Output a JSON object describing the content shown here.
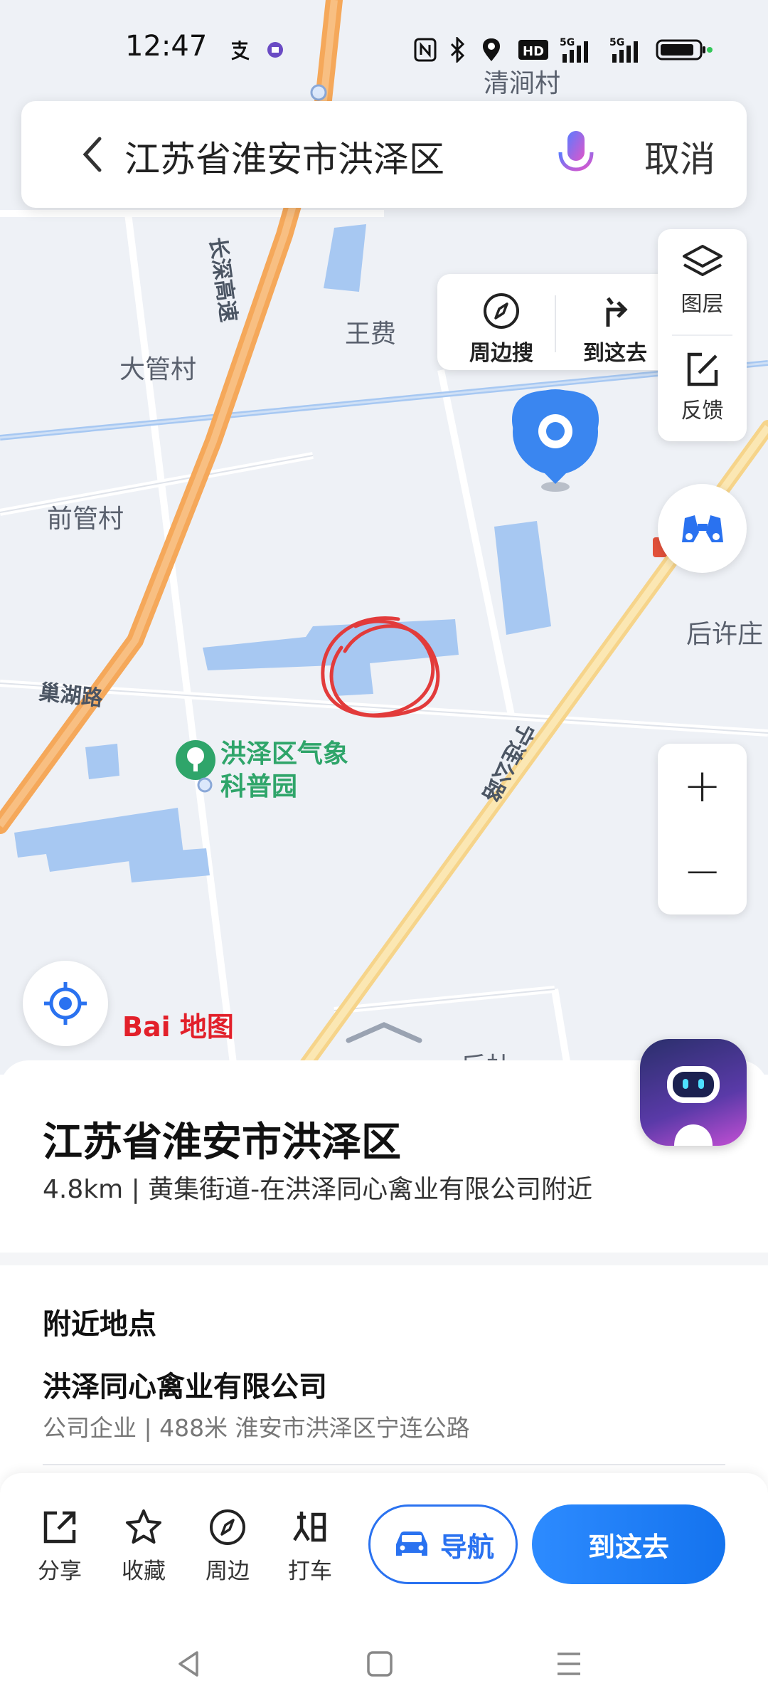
{
  "status_bar": {
    "time": "12:47",
    "icons": [
      "alipay-icon",
      "app-notification-icon",
      "nfc-icon",
      "bluetooth-icon",
      "location-icon",
      "hd-icon",
      "signal-5g-icon",
      "signal-5g-icon",
      "battery-icon"
    ],
    "hd_label": "HD",
    "net1": "5G",
    "net2": "5G"
  },
  "search": {
    "query": "江苏省淮安市洪泽区",
    "cancel_label": "取消"
  },
  "map": {
    "labels": {
      "qingjian": "清涧村",
      "wangfei": "王费",
      "daguan": "大管村",
      "qianguan": "前管村",
      "houxu": "后许庄",
      "chaohu": "巢湖路",
      "highway": "长深高速",
      "ninglian": "宁连公路",
      "park_line1": "洪泽区气象",
      "park_line2": "科普园",
      "partial_bottom": "后杜"
    },
    "logo": "Bai 地图"
  },
  "controls": {
    "nearby_search": "周边搜",
    "go_here": "到这去",
    "layers": "图层",
    "feedback": "反馈",
    "zoom_in": "+",
    "zoom_out": "−"
  },
  "sheet": {
    "title": "江苏省淮安市洪泽区",
    "subtitle": "4.8km | 黄集街道-在洪泽同心禽业有限公司附近",
    "nearby_heading": "附近地点",
    "poi": {
      "name": "洪泽同心禽业有限公司",
      "meta": "公司企业 | 488米 淮安市洪泽区宁连公路"
    }
  },
  "actions": {
    "share": "分享",
    "favorite": "收藏",
    "nearby": "周边",
    "taxi": "打车",
    "navigate": "导航",
    "go": "到这去"
  },
  "colors": {
    "accent": "#2a72f0",
    "highway": "#f5a85a",
    "secondary_road": "#f6d48a",
    "water": "#a7c8f2",
    "park_green": "#2fa56a",
    "annotation_red": "#e23b3b"
  }
}
